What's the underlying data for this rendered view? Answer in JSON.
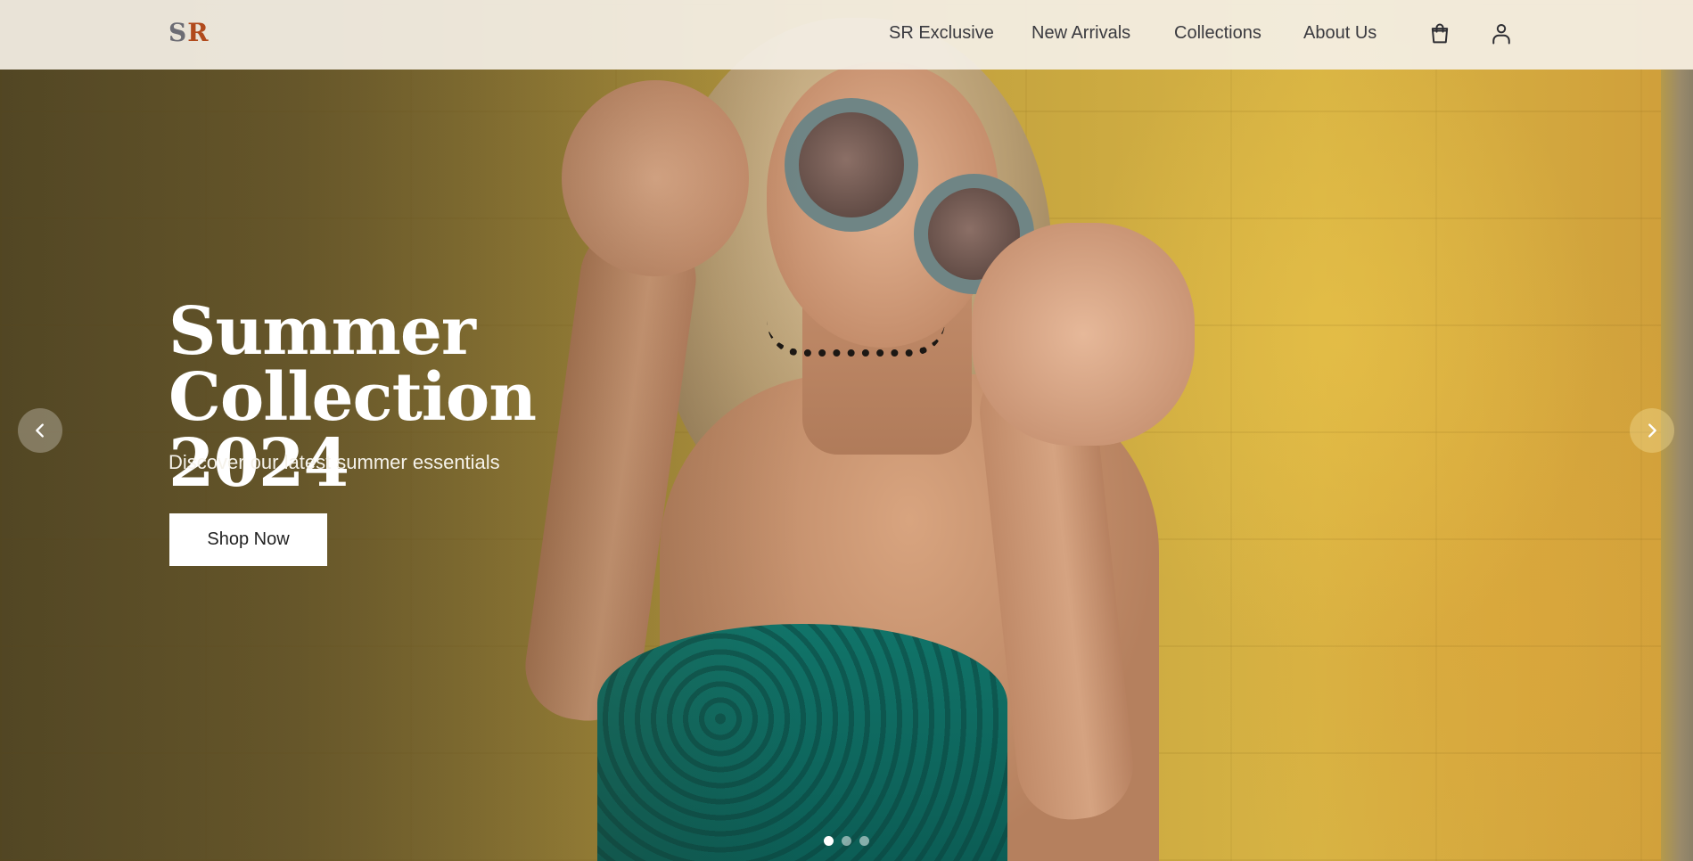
{
  "brand": {
    "logo_s": "S",
    "logo_r": "R"
  },
  "nav": {
    "items": [
      {
        "label": "SR Exclusive"
      },
      {
        "label": "New Arrivals"
      },
      {
        "label": "Collections"
      },
      {
        "label": "About Us"
      }
    ],
    "cart_icon": "shopping-bag-icon",
    "account_icon": "user-icon"
  },
  "hero": {
    "title_line1": "Summer",
    "title_line2": "Collection 2024",
    "subtitle": "Discover our latest summer essentials",
    "cta_label": "Shop Now"
  },
  "carousel": {
    "prev_icon": "chevron-left-icon",
    "next_icon": "chevron-right-icon",
    "slides_count": 3,
    "active_slide": 1
  },
  "colors": {
    "logo_s": "#6c6c74",
    "logo_r": "#b14a1c",
    "header_bg": "#f4efe5",
    "cta_bg": "#ffffff"
  }
}
